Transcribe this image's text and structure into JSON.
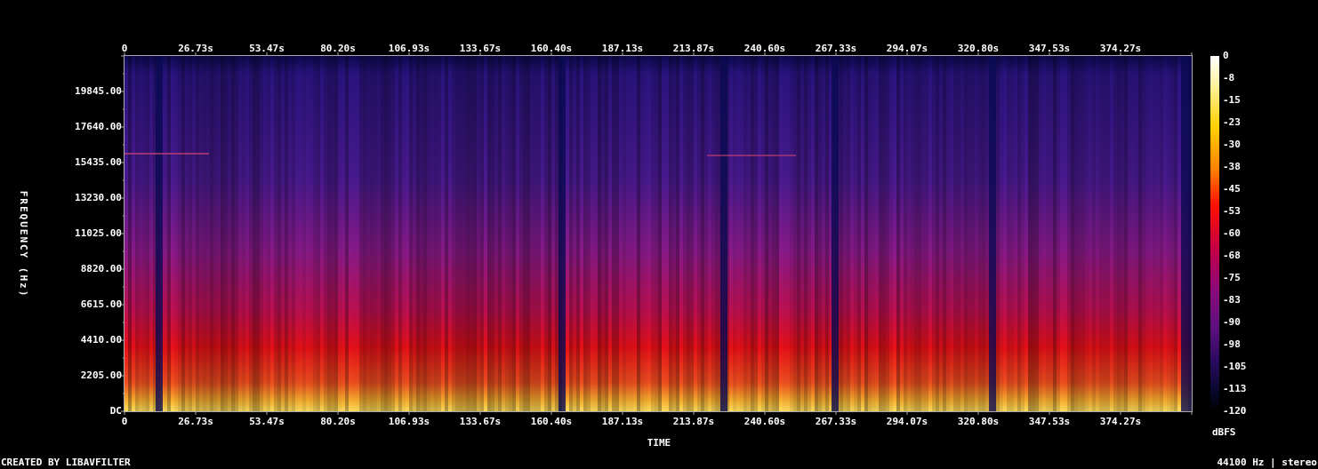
{
  "x_axis": {
    "top_ticks": [
      "0",
      "26.73s",
      "53.47s",
      "80.20s",
      "106.93s",
      "133.67s",
      "160.40s",
      "187.13s",
      "213.87s",
      "240.60s",
      "267.33s",
      "294.07s",
      "320.80s",
      "347.53s",
      "374.27s"
    ],
    "bottom_ticks": [
      "0",
      "26.73s",
      "53.47s",
      "80.20s",
      "106.93s",
      "133.67s",
      "160.40s",
      "187.13s",
      "213.87s",
      "240.60s",
      "267.33s",
      "294.07s",
      "320.80s",
      "347.53s",
      "374.27s"
    ],
    "label": "TIME"
  },
  "y_axis": {
    "ticks": [
      "19845.00",
      "17640.00",
      "15435.00",
      "13230.00",
      "11025.00",
      "8820.00",
      "6615.00",
      "4410.00",
      "2205.00",
      "DC"
    ],
    "label": "FREQUENCY (Hz)"
  },
  "colorbar": {
    "ticks": [
      "0",
      "-8",
      "-15",
      "-23",
      "-30",
      "-38",
      "-45",
      "-53",
      "-60",
      "-68",
      "-75",
      "-83",
      "-90",
      "-98",
      "-105",
      "-113",
      "-120"
    ],
    "unit": "dBFS"
  },
  "footer": {
    "credit": "CREATED BY LIBAVFILTER",
    "info": "44100 Hz | stereo"
  }
}
